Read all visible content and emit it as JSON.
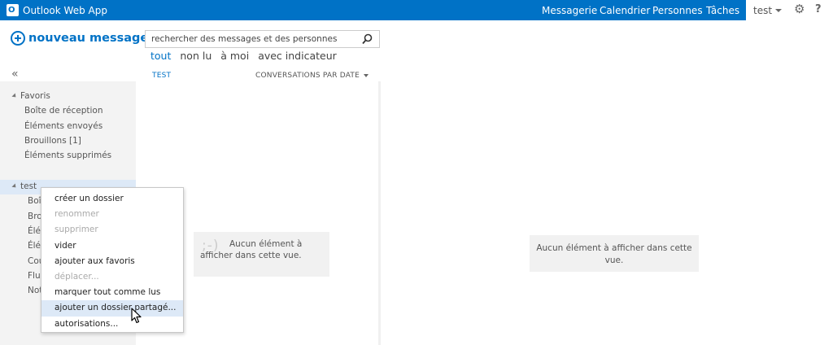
{
  "app": {
    "title": "Outlook Web App",
    "logo": "O"
  },
  "topnav": {
    "items": [
      {
        "label": "Messagerie",
        "icon": ""
      },
      {
        "label": "Calendrier"
      },
      {
        "label": "Personnes"
      },
      {
        "label": "Tâches"
      }
    ],
    "user": "test",
    "settings_icon": "gear-icon",
    "help_label": "?"
  },
  "compose": {
    "label": "nouveau message",
    "icon": "plus-circle-icon"
  },
  "collapse_label": "«",
  "search": {
    "placeholder": "rechercher des messages et des personnes",
    "value": ""
  },
  "filters": [
    "tout",
    "non lu",
    "à moi",
    "avec indicateur"
  ],
  "list": {
    "folder_title": "TEST",
    "sort_label": "CONVERSATIONS PAR DATE",
    "empty_smiley": ";-)",
    "empty_text": "Aucun élément à afficher dans cette vue."
  },
  "reading": {
    "empty_text": "Aucun élément à afficher dans cette vue."
  },
  "favorites": {
    "title": "Favoris",
    "folders": [
      "Boîte de réception",
      "Éléments envoyés",
      "Brouillons [1]",
      "Éléments supprimés"
    ]
  },
  "mailbox": {
    "title": "test",
    "folders": [
      "Boî",
      "Bro",
      "Élé",
      "Élé",
      "Cou",
      "Flu",
      "Not"
    ]
  },
  "context_menu": {
    "items": [
      {
        "label": "créer un dossier",
        "disabled": false
      },
      {
        "label": "renommer",
        "disabled": true
      },
      {
        "label": "supprimer",
        "disabled": true
      },
      {
        "label": "vider",
        "disabled": false
      },
      {
        "label": "ajouter aux favoris",
        "disabled": false
      },
      {
        "label": "déplacer...",
        "disabled": true
      },
      {
        "label": "marquer tout comme lus",
        "disabled": false
      },
      {
        "label": "ajouter un dossier partagé...",
        "disabled": false,
        "highlighted": true
      },
      {
        "label": "autorisations...",
        "disabled": false
      }
    ]
  },
  "colors": {
    "accent": "#0072c6",
    "pane": "#f3f3f3",
    "selection": "#dde9f7"
  }
}
